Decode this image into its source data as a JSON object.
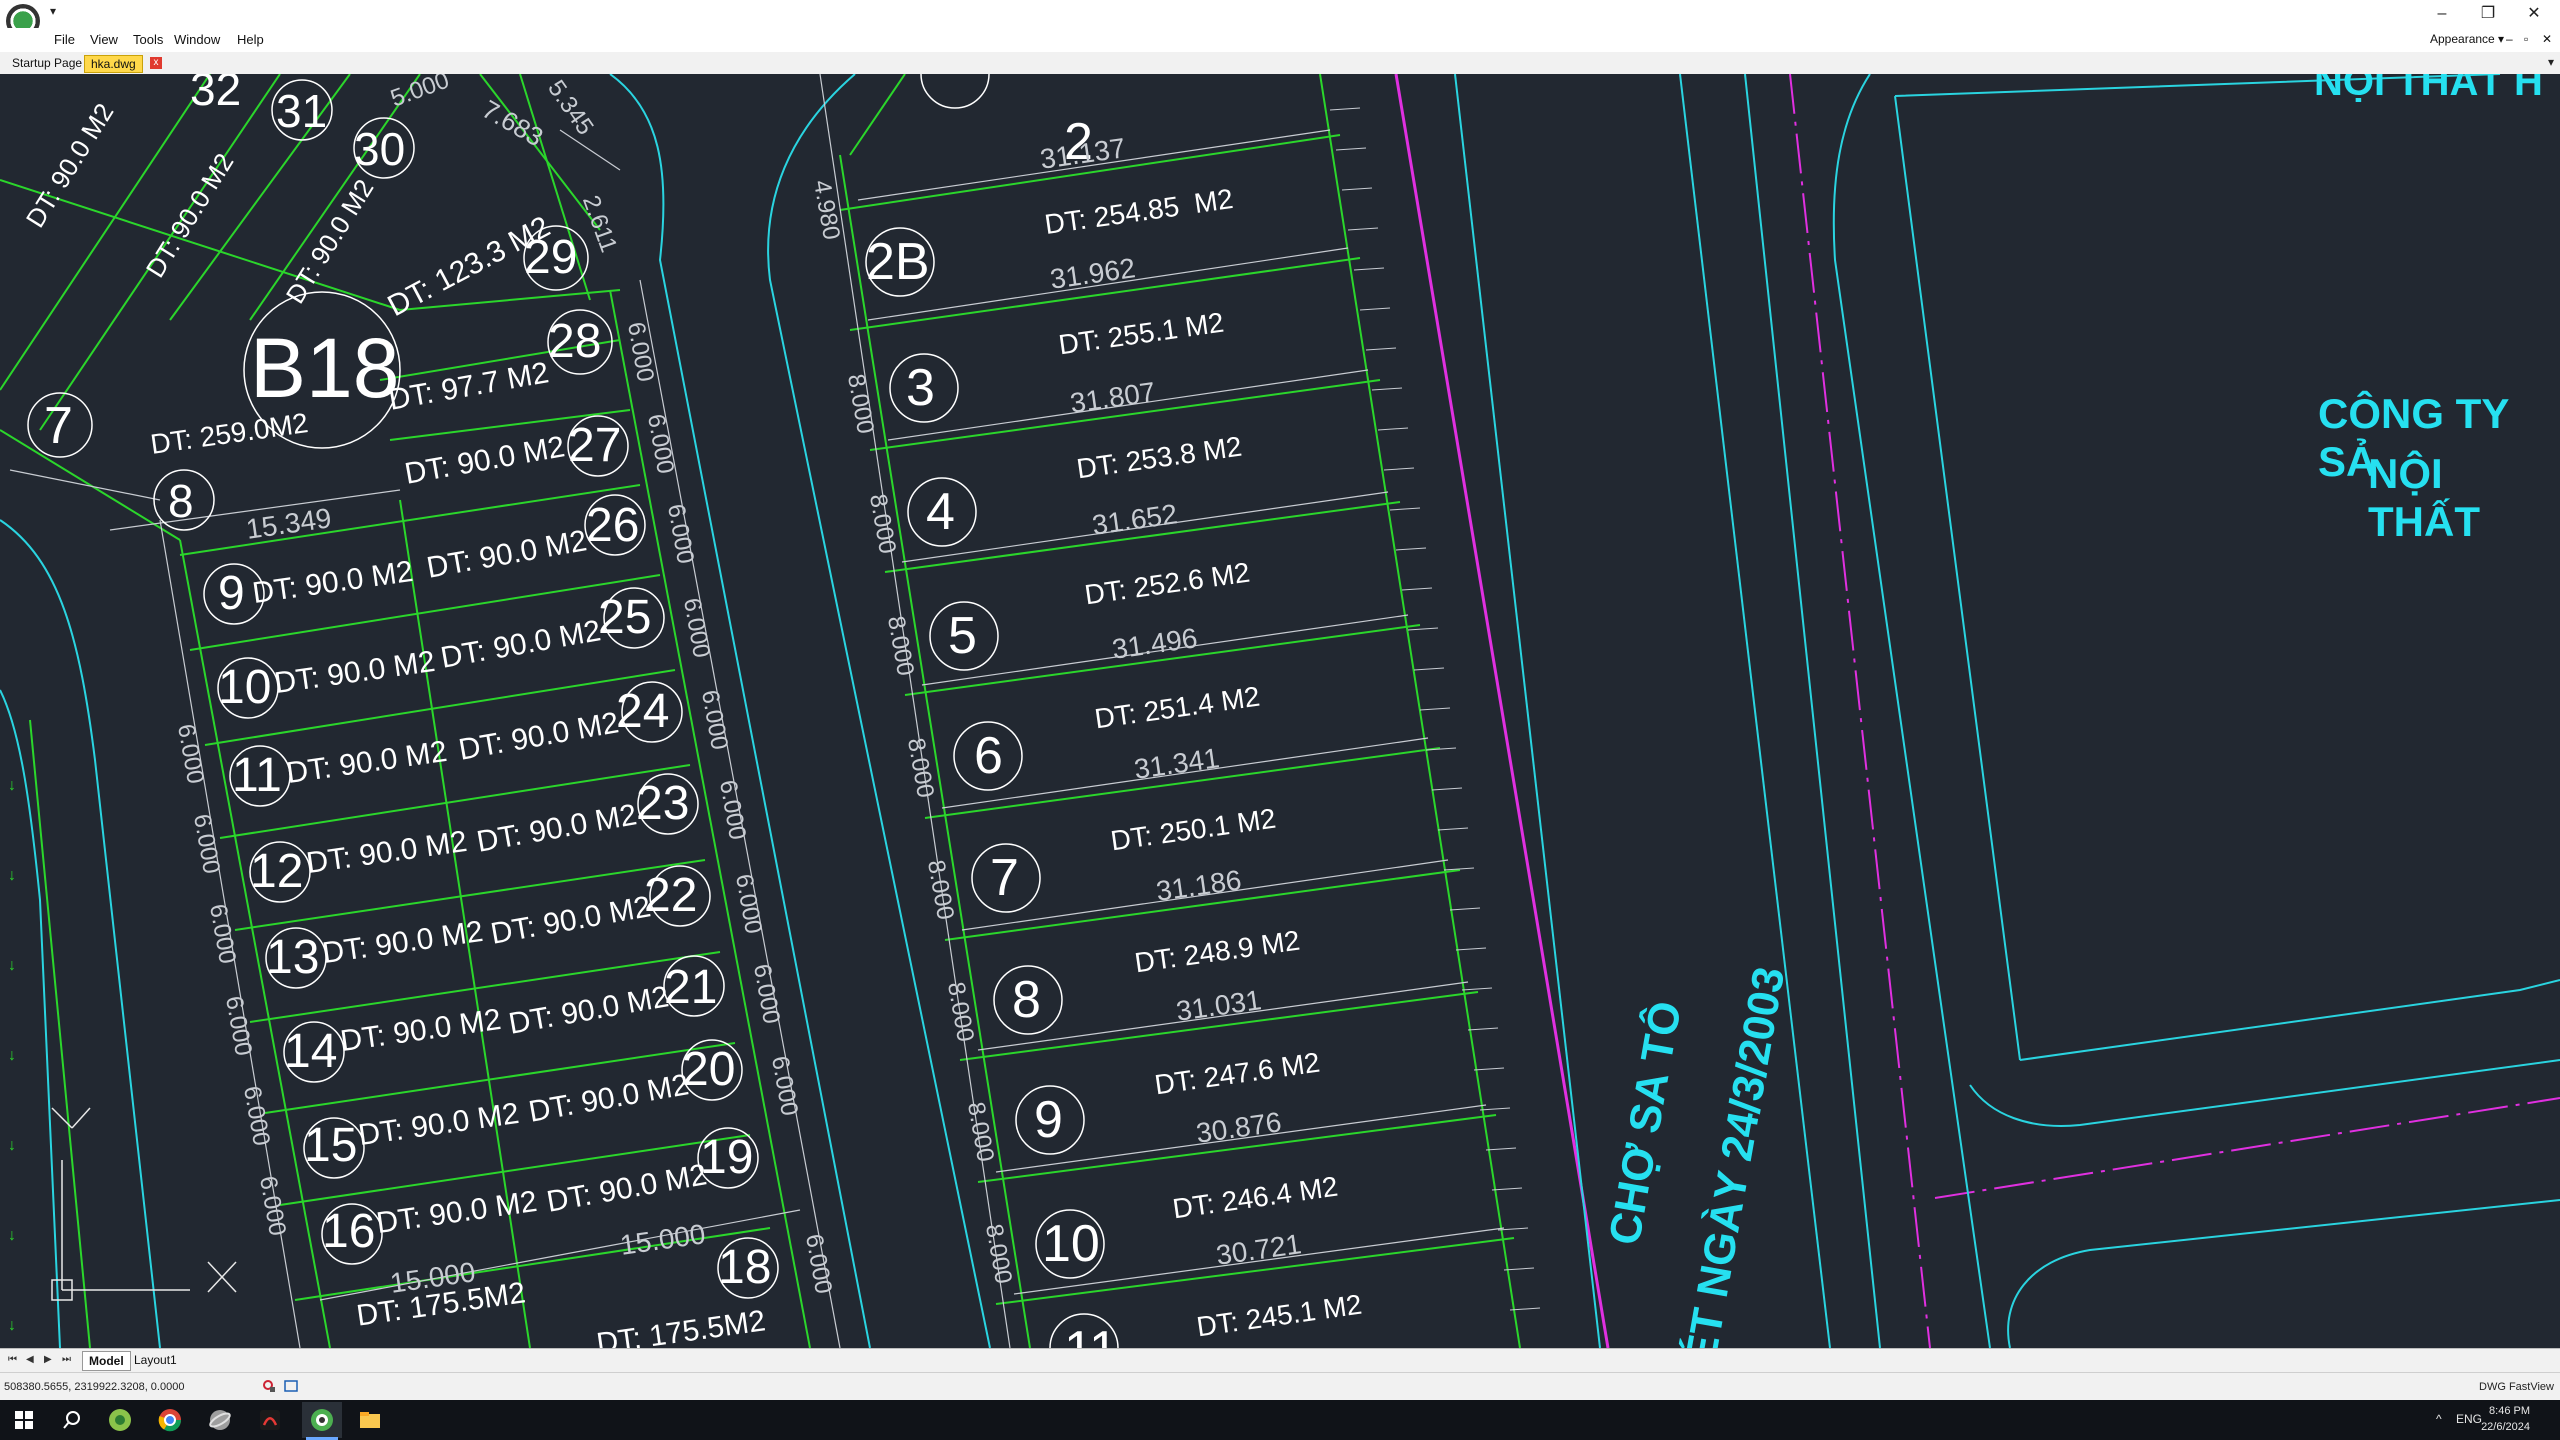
{
  "menus": [
    "File",
    "View",
    "Tools",
    "Window",
    "Help"
  ],
  "appearance_label": "Appearance",
  "tabs": {
    "startup": "Startup Page",
    "file": "hka.dwg",
    "close": "x"
  },
  "layouts": [
    "Model",
    "Layout1"
  ],
  "status": {
    "coords": "508380.5655, 2319922.3208, 0.0000",
    "app": "DWG FastView"
  },
  "tray": {
    "lang": "ENG",
    "time": "8:46 PM",
    "date": "22/6/2024"
  },
  "colors": {
    "canvas": "#222831",
    "lot_line": "#2bd62b",
    "road": "#2ad4e0",
    "boundary": "#e030e0",
    "label": "#26e0f0",
    "text": "#ffffff"
  },
  "drawing": {
    "block_label": "B18",
    "block_area": "DT: 259.0M2",
    "lots_left_inner": [
      {
        "num": "7",
        "area": ""
      },
      {
        "num": "8",
        "area": ""
      },
      {
        "num": "9",
        "area": "DT: 90.0 M2"
      },
      {
        "num": "10",
        "area": "DT: 90.0 M2"
      },
      {
        "num": "11",
        "area": "DT: 90.0 M2"
      },
      {
        "num": "12",
        "area": "DT: 90.0 M2"
      },
      {
        "num": "13",
        "area": "DT: 90.0 M2"
      },
      {
        "num": "14",
        "area": "DT: 90.0 M2"
      },
      {
        "num": "15",
        "area": "DT: 90.0 M2"
      },
      {
        "num": "16",
        "area": "DT: 90.0 M2"
      }
    ],
    "lots_left_outer": [
      {
        "num": "29",
        "area": "DT: 123.3 M2"
      },
      {
        "num": "28",
        "area": "DT: 97.7 M2"
      },
      {
        "num": "27",
        "area": "DT: 90.0 M2"
      },
      {
        "num": "26",
        "area": "DT: 90.0 M2"
      },
      {
        "num": "25",
        "area": "DT: 90.0 M2"
      },
      {
        "num": "24",
        "area": "DT: 90.0 M2"
      },
      {
        "num": "23",
        "area": "DT: 90.0 M2"
      },
      {
        "num": "22",
        "area": "DT: 90.0 M2"
      },
      {
        "num": "21",
        "area": "DT: 90.0 M2"
      },
      {
        "num": "20",
        "area": "DT: 90.0 M2"
      },
      {
        "num": "19",
        "area": "DT: 90.0 M2"
      },
      {
        "num": "18",
        "area": ""
      }
    ],
    "lots_top": [
      {
        "num": "31",
        "area": "DT: 90.0 M2"
      },
      {
        "num": "30",
        "area": "DT: 90.0 M2"
      },
      {
        "num": "32",
        "area": "DT: 90.0 M2"
      }
    ],
    "lots_right": [
      {
        "num": "2",
        "area": "",
        "dim": "31.137"
      },
      {
        "num": "2B",
        "area": "DT: 254.85  M2",
        "dim": "31.962"
      },
      {
        "num": "3",
        "area": "DT: 255.1 M2",
        "dim": "31.807"
      },
      {
        "num": "4",
        "area": "DT: 253.8 M2",
        "dim": "31.652"
      },
      {
        "num": "5",
        "area": "DT: 252.6 M2",
        "dim": "31.496"
      },
      {
        "num": "6",
        "area": "DT: 251.4 M2",
        "dim": "31.341"
      },
      {
        "num": "7",
        "area": "DT: 250.1 M2",
        "dim": "31.186"
      },
      {
        "num": "8",
        "area": "DT: 248.9 M2",
        "dim": "31.031"
      },
      {
        "num": "9",
        "area": "DT: 247.6 M2",
        "dim": "30.876"
      },
      {
        "num": "10",
        "area": "DT: 246.4 M2",
        "dim": "30.721"
      },
      {
        "num": "11",
        "area": "DT: 245.1 M2",
        "dim": ""
      }
    ],
    "bottom_areas": [
      "DT: 175.5M2",
      "DT: 175.5M2"
    ],
    "dims": {
      "d15349": "15.349",
      "d15000": "15.000",
      "d6000": "6.000",
      "d8000": "8.000",
      "d7683": "7.683",
      "d2611": "2.611",
      "d5345": "5.345",
      "d4980": "4.980",
      "d5000": "5.000"
    },
    "company_lines": [
      "CÔNG TY SẢ",
      "NỘI THẤT"
    ],
    "top_text": "NỘI THẤT H",
    "road_text_1": "CHỢ SA TÔ",
    "road_text_2": "ÉT NGÀY 24/3/2003"
  }
}
